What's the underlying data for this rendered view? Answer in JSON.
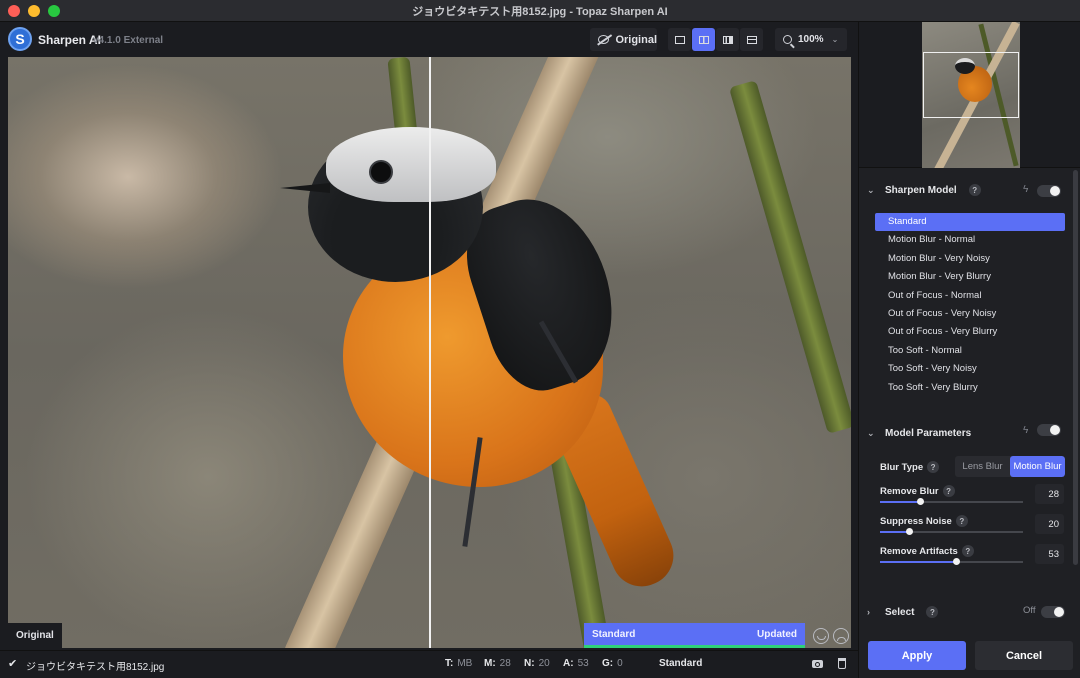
{
  "window": {
    "title": "ジョウビタキテスト用8152.jpg - Topaz Sharpen AI"
  },
  "toolbar": {
    "logo_letter": "S",
    "app_name": "Sharpen AI",
    "app_version": "v4.1.0 External",
    "original_button": "Original",
    "view_modes": [
      "single-view-icon",
      "split-view-icon",
      "side-by-side-view-icon",
      "stacked-view-icon"
    ],
    "active_view_mode": "split-view-icon",
    "zoom": "100%"
  },
  "canvas": {
    "original_label": "Original",
    "status_model": "Standard",
    "status_state": "Updated",
    "split_position_percent": 50
  },
  "bottombar": {
    "filename": "ジョウビタキテスト用8152.jpg",
    "stats": [
      {
        "key": "T:",
        "value": "MB"
      },
      {
        "key": "M:",
        "value": "28"
      },
      {
        "key": "N:",
        "value": "20"
      },
      {
        "key": "A:",
        "value": "53"
      },
      {
        "key": "G:",
        "value": "0"
      }
    ],
    "model": "Standard"
  },
  "panel": {
    "sharpen_model": {
      "title": "Sharpen Model",
      "help": "?",
      "items": [
        "Standard",
        "Motion Blur - Normal",
        "Motion Blur - Very Noisy",
        "Motion Blur - Very Blurry",
        "Out of Focus - Normal",
        "Out of Focus - Very Noisy",
        "Out of Focus - Very Blurry",
        "Too Soft - Normal",
        "Too Soft - Very Noisy",
        "Too Soft - Very Blurry"
      ],
      "selected": "Standard"
    },
    "model_parameters": {
      "title": "Model Parameters",
      "help": "?",
      "blur_type_label": "Blur Type",
      "blur_options": [
        "Lens Blur",
        "Motion Blur"
      ],
      "blur_selected": "Motion Blur",
      "sliders": [
        {
          "label": "Remove Blur",
          "value": "28",
          "max": 100
        },
        {
          "label": "Suppress Noise",
          "value": "20",
          "max": 100
        },
        {
          "label": "Remove Artifacts",
          "value": "53",
          "max": 100
        }
      ]
    },
    "select": {
      "title": "Select",
      "help": "?",
      "state": "Off"
    },
    "apply_button": "Apply",
    "cancel_button": "Cancel"
  },
  "colors": {
    "accent": "#5b6ff5",
    "updated_indicator": "#2fd17a",
    "panel_bg": "#1f2024"
  }
}
